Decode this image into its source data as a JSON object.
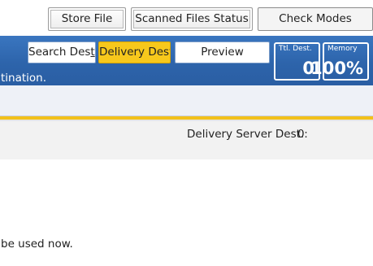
{
  "top_tabs": {
    "store_file": "Store File",
    "scanned_status": "Scanned Files Status",
    "check_modes": "Check Modes"
  },
  "dest_tabs": {
    "search_dest": "Search Dest.",
    "delivery_dest": "Delivery Dest.",
    "preview": "Preview"
  },
  "header_message": "tination.",
  "counters": {
    "total_dest_label": "Ttl. Dest.",
    "total_dest_value": "0",
    "memory_label": "Memory",
    "memory_value": "100%"
  },
  "server": {
    "label": "Delivery Server Dest.:",
    "count": "0"
  },
  "bottom_message": "be used now.",
  "colors": {
    "header_blue": "#2d64ab",
    "selected_tab": "#f7c81c",
    "rule_yellow": "#f2c11a"
  }
}
